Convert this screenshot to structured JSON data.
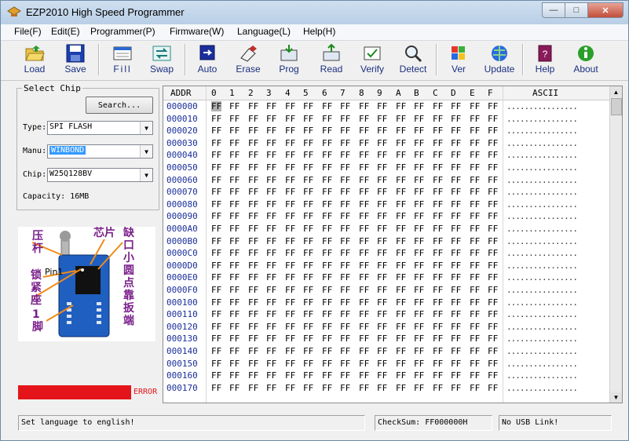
{
  "window": {
    "title": "EZP2010 High Speed Programmer"
  },
  "menu": [
    "File(F)",
    "Edit(E)",
    "Programmer(P)",
    "Firmware(W)",
    "Language(L)",
    "Help(H)"
  ],
  "toolbar": [
    {
      "label": "Load",
      "icon": "folder-open-icon"
    },
    {
      "label": "Save",
      "icon": "floppy-disk-icon"
    },
    {
      "label": "Fill",
      "icon": "fill-icon"
    },
    {
      "label": "Swap",
      "icon": "swap-icon"
    },
    {
      "label": "Auto",
      "icon": "auto-icon"
    },
    {
      "label": "Erase",
      "icon": "erase-icon"
    },
    {
      "label": "Prog",
      "icon": "program-icon"
    },
    {
      "label": "Read",
      "icon": "read-icon"
    },
    {
      "label": "Verify",
      "icon": "verify-icon"
    },
    {
      "label": "Detect",
      "icon": "detect-icon"
    },
    {
      "label": "Ver",
      "icon": "version-icon"
    },
    {
      "label": "Update",
      "icon": "update-icon"
    },
    {
      "label": "Help",
      "icon": "help-book-icon"
    },
    {
      "label": "About",
      "icon": "info-icon"
    }
  ],
  "chip_panel": {
    "group_title": "Select Chip",
    "search_label": "Search...",
    "type_label": "Type:",
    "type_value": "SPI FLASH",
    "manu_label": "Manu:",
    "manu_value": "WINBOND",
    "chip_label": "Chip:",
    "chip_value": "W25Q128BV",
    "capacity": "Capacity: 16MB"
  },
  "chip_diagram": {
    "lever": "压杆",
    "chip": "芯片",
    "notch": "缺口小圆点靠扳端",
    "lock_seat": "锁紧座",
    "pin1": "Pin1",
    "pin1_foot": "1脚"
  },
  "status_indicator": {
    "text": "ERROR",
    "color": "#e3151a"
  },
  "hex_view": {
    "addr_header": "ADDR",
    "columns": [
      "0",
      "1",
      "2",
      "3",
      "4",
      "5",
      "6",
      "7",
      "8",
      "9",
      "A",
      "B",
      "C",
      "D",
      "E",
      "F"
    ],
    "ascii_header": "ASCII",
    "addresses": [
      "000000",
      "000010",
      "000020",
      "000030",
      "000040",
      "000050",
      "000060",
      "000070",
      "000080",
      "000090",
      "0000A0",
      "0000B0",
      "0000C0",
      "0000D0",
      "0000E0",
      "0000F0",
      "000100",
      "000110",
      "000120",
      "000130",
      "000140",
      "000150",
      "000160",
      "000170"
    ],
    "fill_byte": "FF",
    "ascii_row": "................"
  },
  "status_bar": {
    "message": "Set language to english!",
    "checksum": "CheckSum: FF000000H",
    "usb": "No USB Link!"
  }
}
